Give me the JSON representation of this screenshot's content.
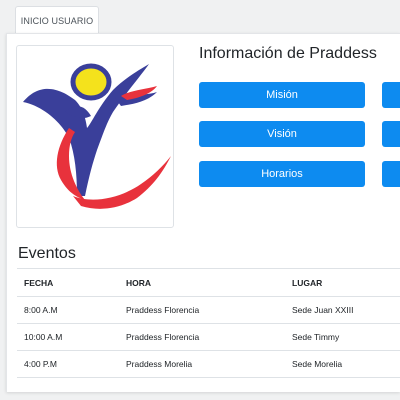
{
  "tabs": [
    {
      "label": "INICIO USUARIO",
      "active": true
    }
  ],
  "info": {
    "title": "Información de Praddess",
    "buttons": [
      {
        "label": "Misión"
      },
      {
        "label": "Visión"
      },
      {
        "label": "Horarios"
      }
    ]
  },
  "events": {
    "title": "Eventos",
    "columns": [
      "FECHA",
      "HORA",
      "LUGAR"
    ],
    "rows": [
      [
        "8:00 A.M",
        "Praddess Florencia",
        "Sede Juan XXIII"
      ],
      [
        "10:00 A.M",
        "Praddess Florencia",
        "Sede Timmy"
      ],
      [
        "4:00 P.M",
        "Praddess Morelia",
        "Sede Morelia"
      ]
    ]
  },
  "colors": {
    "button": "#0d8bf0",
    "logo_blue": "#3a3f9a",
    "logo_red": "#e8323c",
    "logo_yellow": "#f4e21c"
  }
}
